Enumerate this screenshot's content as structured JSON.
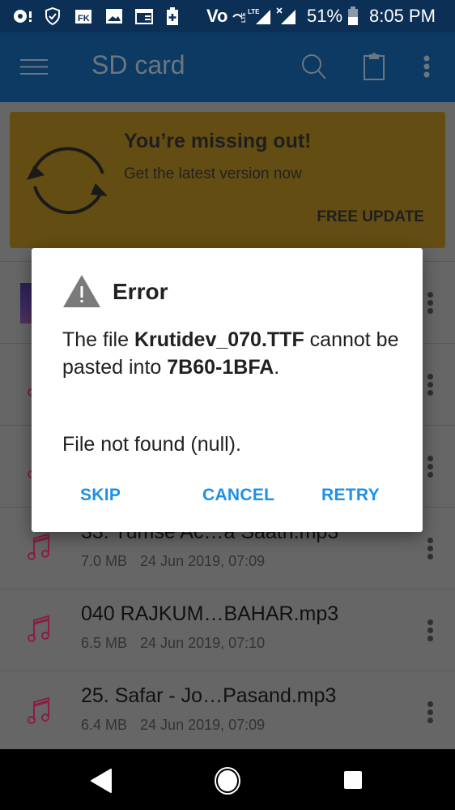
{
  "status_bar": {
    "battery_percent": "51%",
    "time": "8:05 PM",
    "icons": [
      "record-alert-icon",
      "shield-check-icon",
      "fk-app-icon",
      "gallery-icon",
      "calendar-icon",
      "battery-saver-icon",
      "volte-icon",
      "lte-signal-icon",
      "signal-no-data-icon",
      "battery-icon"
    ],
    "network_label": "Vo"
  },
  "app_bar": {
    "title": "SD card",
    "icons": [
      "menu-icon",
      "search-icon",
      "clipboard-icon",
      "more-vert-icon"
    ]
  },
  "banner": {
    "title": "You’re missing out!",
    "subtitle": "Get the latest version now",
    "button": "FREE UPDATE",
    "color": "#634d12"
  },
  "files": [
    {
      "name": "",
      "size": "",
      "date": "",
      "type": "image"
    },
    {
      "name": "",
      "size": "",
      "date": "",
      "type": "audio"
    },
    {
      "name": "",
      "size": "",
      "date": "",
      "type": "audio"
    },
    {
      "name": "33. Tumse Ac…a Saath.mp3",
      "size": "7.0 MB",
      "date": "24 Jun 2019, 07:09",
      "type": "audio"
    },
    {
      "name": "040 RAJKUM…BAHAR.mp3",
      "size": "6.5 MB",
      "date": "24 Jun 2019, 07:10",
      "type": "audio"
    },
    {
      "name": "25. Safar - Jo…Pasand.mp3",
      "size": "6.4 MB",
      "date": "24 Jun 2019, 07:09",
      "type": "audio"
    }
  ],
  "dialog": {
    "title": "Error",
    "body_prefix": "The file ",
    "file_name": "Krutidev_070.TTF",
    "body_middle": " cannot be pasted into ",
    "destination": "7B60-1BFA",
    "body_suffix": ".",
    "note": "File not found (null).",
    "buttons": {
      "skip": "SKIP",
      "cancel": "CANCEL",
      "retry": "RETRY"
    },
    "accent": "#1e90e8"
  },
  "nav_bar": {
    "icons": [
      "back-icon",
      "home-icon",
      "recents-icon"
    ]
  }
}
